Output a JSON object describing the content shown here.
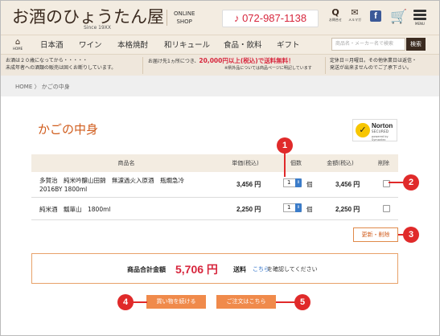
{
  "header": {
    "logo": "お酒のひょうたん屋",
    "since": "Since 19XX",
    "online_shop_1": "ONLINE",
    "online_shop_2": "SHOP",
    "phone": "072-987-1138",
    "icons": [
      {
        "icon": "search-icon",
        "glyph": "Q",
        "label": "お問合せ"
      },
      {
        "icon": "mail-icon",
        "glyph": "✉",
        "label": "メルマガ"
      }
    ],
    "facebook": "f",
    "menu_label": "MENU"
  },
  "nav": {
    "home_label": "HOME",
    "items": [
      "日本酒",
      "ワイン",
      "本格焼酎",
      "和リキュール",
      "食品・飲料",
      "ギフト"
    ],
    "search_placeholder": "商品名・メーカー名で検索",
    "search_button": "検索"
  },
  "notices": {
    "left_1": "お酒は２０歳になってから・・・・・",
    "left_2": "未成年者への酒類の販売は固くお断りしています。",
    "mid_1_pre": "お届け先1ヵ所につき、",
    "mid_1_red": "20,000円以上(税込)で送料無料！",
    "mid_2": "※県外品については商品ページに明記しています",
    "right_1": "定休日＝月曜日。その他休業日は返信・",
    "right_2": "発送が出来ませんのでご了承下さい。"
  },
  "breadcrumb": {
    "home": "HOME",
    "sep": "〉",
    "current": "かごの中身"
  },
  "cart": {
    "title": "かごの中身",
    "norton": {
      "name": "Norton",
      "secured": "SECURED",
      "powered": "powered by Symantec"
    },
    "columns": {
      "name": "商品名",
      "unit_price": "単価(税込)",
      "qty": "個数",
      "amount": "金額(税込)",
      "delete": "削除"
    },
    "items": [
      {
        "name_1": "多賀治　純米吟醸山田錦　無濾過火入原酒　瓶燗急冷",
        "name_2": "2016BY 1800ml",
        "unit_price": "3,456 円",
        "qty": "1",
        "unit": "個",
        "amount": "3,456 円"
      },
      {
        "name_1": "純米酒　瓢箪山　1800ml",
        "name_2": "",
        "unit_price": "2,250 円",
        "qty": "1",
        "unit": "個",
        "amount": "2,250 円"
      }
    ],
    "update_button": "更新・削除",
    "total_label": "商品合計金額",
    "total_amount": "5,706 円",
    "shipping_label": "送料",
    "shipping_link": "こちら",
    "shipping_text": "を確認してください",
    "continue_button": "買い物を続ける",
    "order_button": "ご注文はこちら"
  },
  "callouts": [
    "1",
    "2",
    "3",
    "4",
    "5"
  ],
  "colors": {
    "accent": "#f08a4b",
    "price_red": "#d7263d",
    "callout": "#e02a2a",
    "header_bg": "#f3ece1"
  }
}
